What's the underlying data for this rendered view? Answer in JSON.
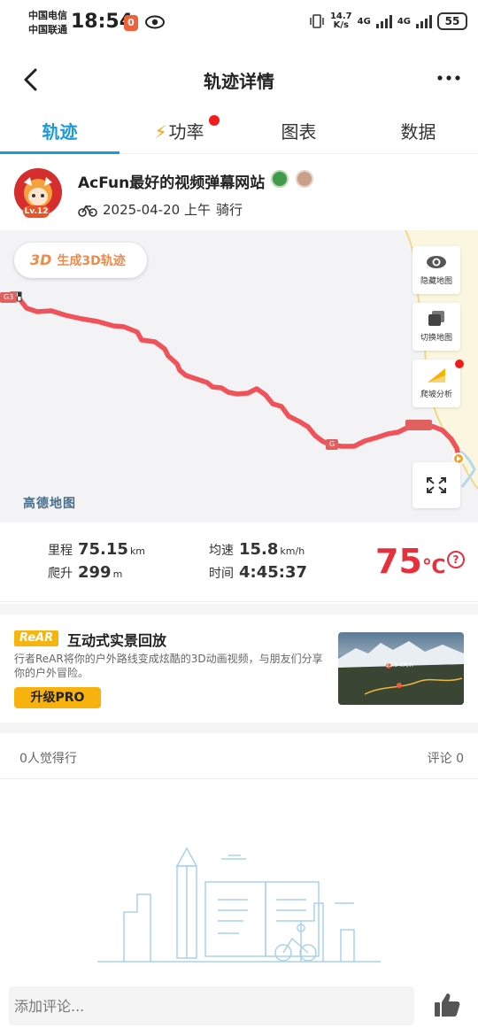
{
  "status_bar": {
    "carrier1": "中国电信",
    "carrier2": "中国联通",
    "time": "18:54",
    "net_speed_value": "14.7",
    "net_speed_unit": "K/s",
    "net1": "4G",
    "net2": "4G",
    "battery": "55"
  },
  "header": {
    "title": "轨迹详情"
  },
  "tabs": [
    {
      "label": "轨迹",
      "active": true
    },
    {
      "label": "功率",
      "badge": true
    },
    {
      "label": "图表"
    },
    {
      "label": "数据"
    }
  ],
  "user": {
    "name": "AcFun最好的视频弹幕网站",
    "level": "Lv.12",
    "date": "2025-04-20 上午",
    "activity": "骑行"
  },
  "map": {
    "btn_3d_prefix": "3D",
    "btn_3d_label": "生成3D轨迹",
    "hide_map": "隐藏地图",
    "switch_map": "切换地图",
    "climb_analysis": "爬坡分析",
    "provider": "高德地图",
    "road_label_1": "G3",
    "road_label_2": "G",
    "route_color": "#f0525a"
  },
  "stats": {
    "distance_label": "里程",
    "distance_value": "75.15",
    "distance_unit": "km",
    "climb_label": "爬升",
    "climb_value": "299",
    "climb_unit": "m",
    "avg_speed_label": "均速",
    "avg_speed_value": "15.8",
    "avg_speed_unit": "km/h",
    "time_label": "时间",
    "time_value": "4:45:37",
    "temperature": "75",
    "temperature_unit": "℃",
    "help": "?"
  },
  "rear": {
    "logo": "ReAR",
    "title": "互动式实景回放",
    "description": "行者ReAR将你的户外路线变成炫酷的3D动画视频，与朋友们分享你的户外冒险。",
    "pro_button": "升级PRO",
    "thumb_speed": "22.3 KM/H"
  },
  "social": {
    "likes": "0人觉得行",
    "comments": "评论 0"
  },
  "bottom": {
    "comment_placeholder": "添加评论..."
  }
}
